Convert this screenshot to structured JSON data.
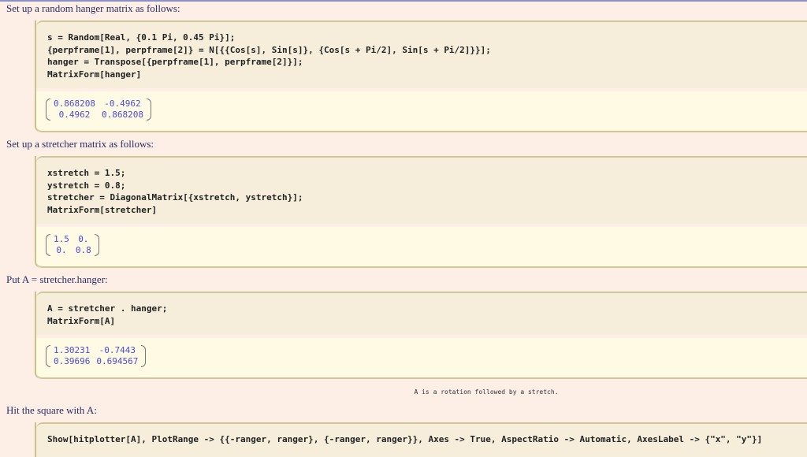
{
  "sections": [
    {
      "text": "Set up a random hanger matrix as follows:",
      "code": [
        "s = Random[Real, {0.1 Pi, 0.45 Pi}];",
        "{perpframe[1], perpframe[2]} = N[{{Cos[s], Sin[s]}, {Cos[s + Pi/2], Sin[s + Pi/2]}}];",
        "hanger = Transpose[{perpframe[1], perpframe[2]}];",
        "MatrixForm[hanger]"
      ],
      "matrix": [
        [
          "0.868208",
          "-0.4962"
        ],
        [
          "0.4962",
          "0.868208"
        ]
      ]
    },
    {
      "text": "Set up a stretcher matrix as follows:",
      "code": [
        "xstretch = 1.5;",
        "ystretch = 0.8;",
        "stretcher = DiagonalMatrix[{xstretch, ystretch}];",
        "MatrixForm[stretcher]"
      ],
      "matrix": [
        [
          "1.5",
          "0."
        ],
        [
          "0.",
          "0.8"
        ]
      ]
    },
    {
      "text": "Put A = stretcher.hanger:",
      "code": [
        "A = stretcher . hanger;",
        "MatrixForm[A]"
      ],
      "matrix": [
        [
          "1.30231",
          "-0.7443"
        ],
        [
          "0.39696",
          "0.694567"
        ]
      ],
      "note": "A is a rotation followed by a stretch."
    },
    {
      "text": "Hit the square with A:",
      "code": [
        "Show[hitplotter[A], PlotRange -> {{-ranger, ranger}, {-ranger, ranger}}, Axes -> True, AspectRatio -> Automatic, AxesLabel -> {\"x\", \"y\"}]"
      ]
    }
  ]
}
